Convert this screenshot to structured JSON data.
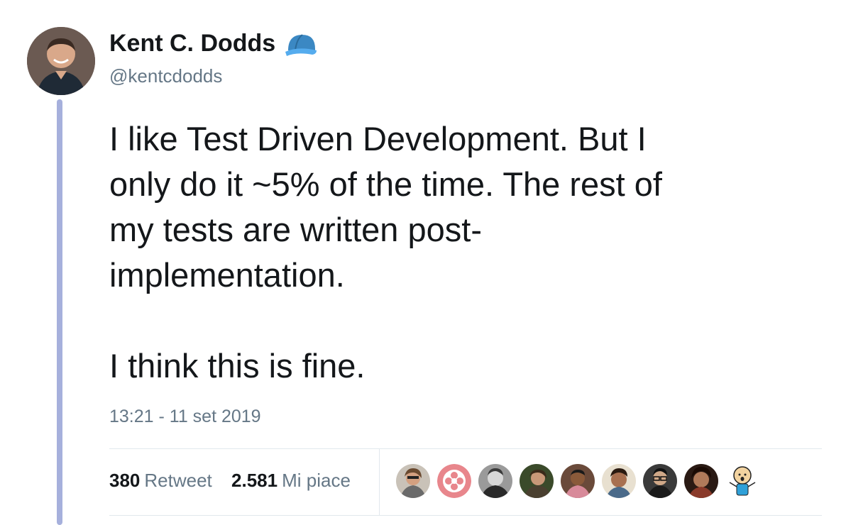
{
  "author": {
    "display_name": "Kent C. Dodds",
    "handle": "@kentcdodds",
    "badge_icon": "baseball-cap-icon"
  },
  "tweet": {
    "text": "I like Test Driven Development. But I\nonly do it ~5% of the time. The rest of\nmy tests are written post-\nimplementation.\n\nI think this is fine.",
    "timestamp": "13:21 - 11 set 2019"
  },
  "stats": {
    "retweets_count": "380",
    "retweets_label": "Retweet",
    "likes_count": "2.581",
    "likes_label": "Mi piace"
  },
  "colors": {
    "thread_line": "#a6b0dc",
    "secondary_text": "#657786",
    "cap_blue": "#3b88c3"
  },
  "likers": [
    {
      "icon": "liker-avatar-icon-1",
      "color": "#8a7a6a"
    },
    {
      "icon": "liker-avatar-icon-2",
      "color": "#e8868c"
    },
    {
      "icon": "liker-avatar-icon-3",
      "color": "#3a3a3a"
    },
    {
      "icon": "liker-avatar-icon-4",
      "color": "#4a4030"
    },
    {
      "icon": "liker-avatar-icon-5",
      "color": "#5a3a30"
    },
    {
      "icon": "liker-avatar-icon-6",
      "color": "#4a3a2a"
    },
    {
      "icon": "liker-avatar-icon-7",
      "color": "#2a2a2a"
    },
    {
      "icon": "liker-avatar-icon-8",
      "color": "#6a4a3a"
    },
    {
      "icon": "liker-avatar-icon-9",
      "color": "#2fa0d8"
    }
  ]
}
